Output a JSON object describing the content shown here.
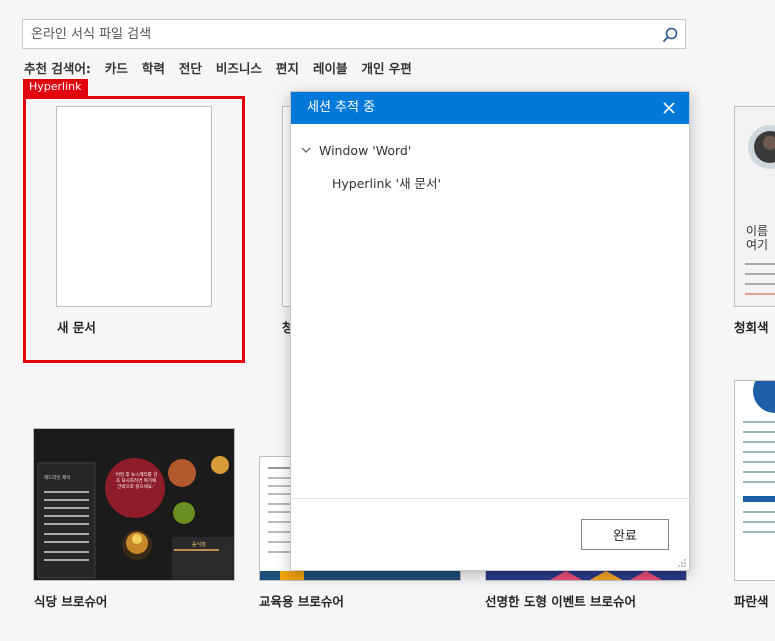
{
  "search": {
    "placeholder": "온라인 서식 파일 검색"
  },
  "suggested": {
    "label": "추천 검색어:",
    "items": [
      "카드",
      "학력",
      "전단",
      "비즈니스",
      "편지",
      "레이블",
      "개인 우편"
    ]
  },
  "hyperlink_tag": "Hyperlink",
  "templates": [
    {
      "name": "새 문서"
    },
    {
      "name": "청"
    },
    {
      "name": "청회색 "
    },
    {
      "name": "식당 브로슈어"
    },
    {
      "name": "교육용 브로슈어"
    },
    {
      "name": "선명한 도형 이벤트 브로슈어"
    },
    {
      "name": "파란색 "
    }
  ],
  "brochure_text": {
    "section_head": "헤드라인 제목",
    "circle_text": "'어떤 후 뉴스레터를 감초 표시하려면 여기에 간략으로 왕으세요.'",
    "logo_text": "음식점",
    "resume_name": "이름 여기"
  },
  "dialog": {
    "title": "세션 추적 중",
    "tree": [
      {
        "label": "Window 'Word'",
        "children": [
          {
            "label": "Hyperlink '새 문서'"
          }
        ]
      }
    ],
    "ok_label": "완료"
  },
  "colors": {
    "accent": "#0078d7",
    "highlight": "#e3000f"
  }
}
